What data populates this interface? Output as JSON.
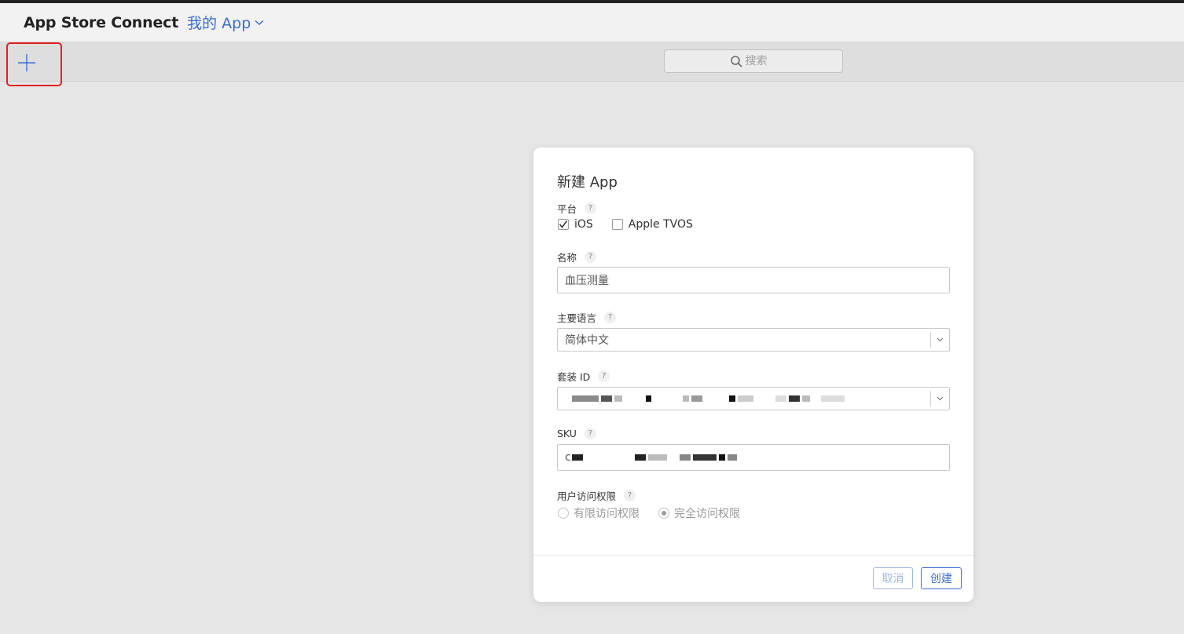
{
  "header": {
    "brand": "App Store Connect",
    "my_apps": "我的 App"
  },
  "toolbar": {
    "search_placeholder": "搜索"
  },
  "dialog": {
    "title": "新建 App",
    "platform": {
      "label": "平台",
      "help": "?",
      "options": [
        {
          "label": "iOS",
          "checked": true
        },
        {
          "label": "Apple TVOS",
          "checked": false
        }
      ]
    },
    "name": {
      "label": "名称",
      "help": "?",
      "value": "血压测量"
    },
    "primary_language": {
      "label": "主要语言",
      "help": "?",
      "value": "简体中文"
    },
    "bundle_id": {
      "label": "套装 ID",
      "help": "?"
    },
    "sku": {
      "label": "SKU",
      "help": "?",
      "value_prefix": "c"
    },
    "user_access": {
      "label": "用户访问权限",
      "help": "?",
      "options": [
        {
          "label": "有限访问权限",
          "selected": false
        },
        {
          "label": "完全访问权限",
          "selected": true
        }
      ]
    },
    "cancel": "取消",
    "create": "创建"
  },
  "colors": {
    "accent": "#3a6ed4",
    "highlight_box": "#e02020",
    "background": "#e6e6e6"
  }
}
